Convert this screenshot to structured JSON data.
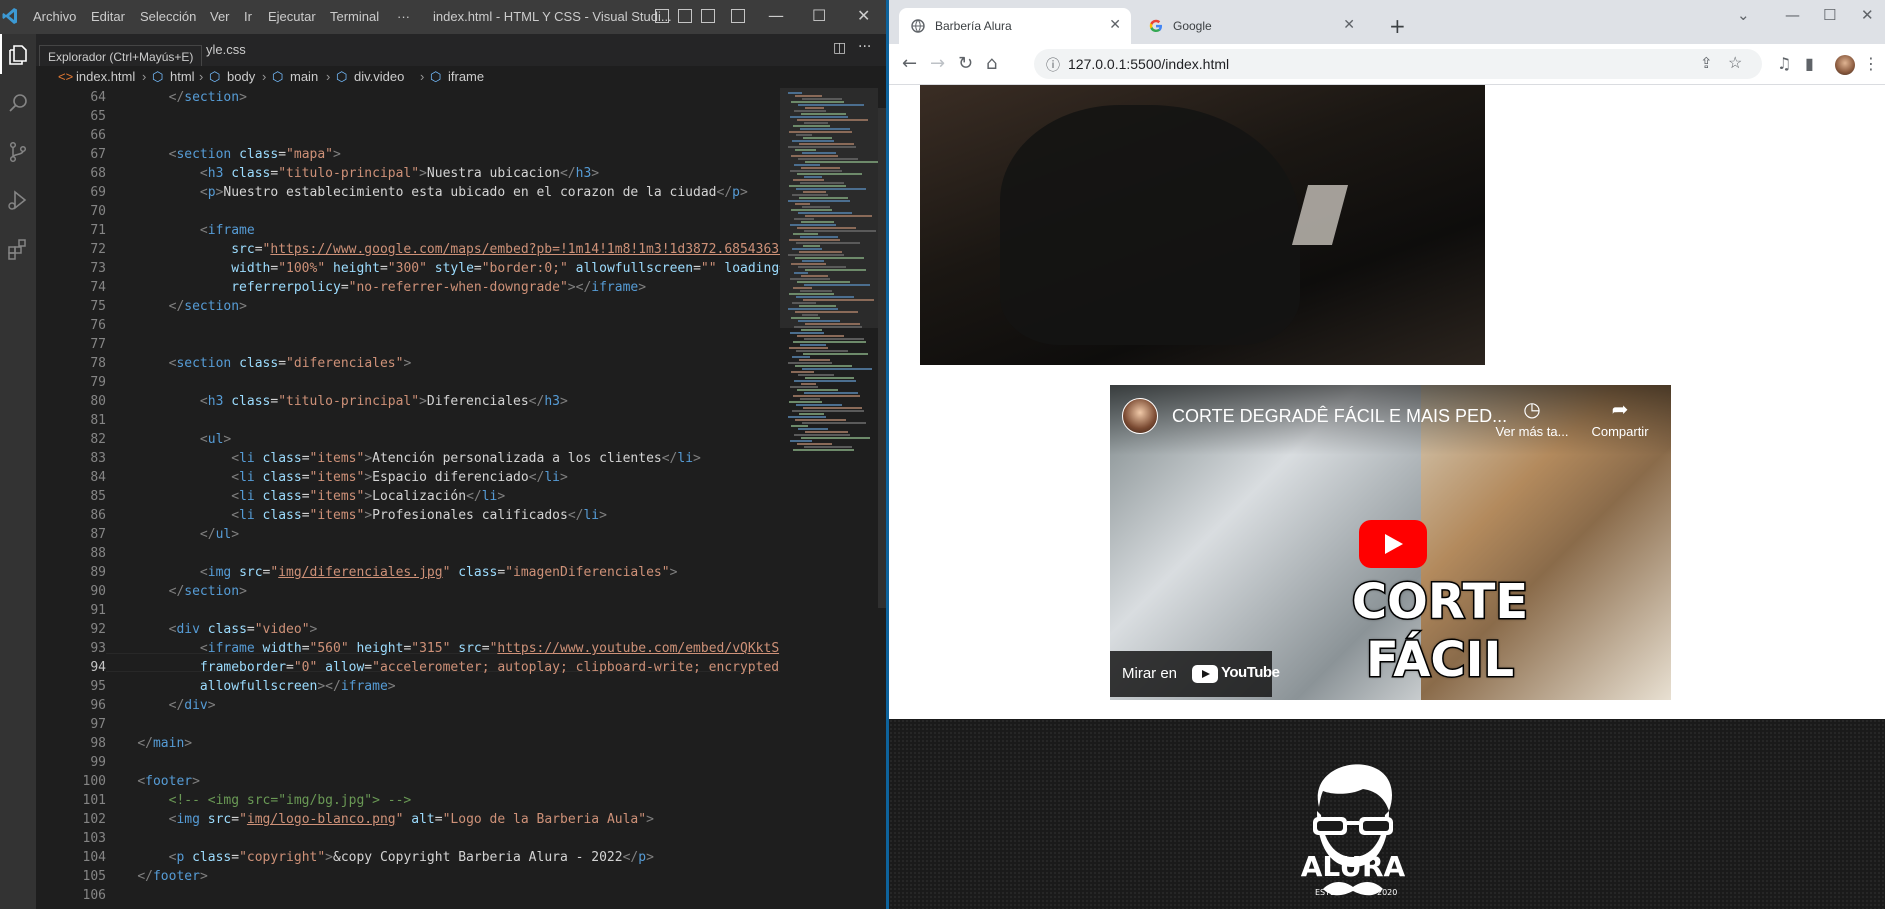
{
  "vscode": {
    "menu": [
      "Archivo",
      "Editar",
      "Selección",
      "Ver",
      "Ir",
      "Ejecutar",
      "Terminal",
      "···"
    ],
    "window_title": "index.html - HTML Y CSS - Visual Studi...",
    "tooltip": "Explorador (Ctrl+Mayús+E)",
    "partial_tab": "yle.css",
    "breadcrumb": [
      "index.html",
      "html",
      "body",
      "main",
      "div.video",
      "iframe"
    ],
    "active_line": 94,
    "line_numbers": [
      64,
      65,
      66,
      67,
      68,
      69,
      70,
      71,
      72,
      73,
      74,
      75,
      76,
      77,
      78,
      79,
      80,
      81,
      82,
      83,
      84,
      85,
      86,
      87,
      88,
      89,
      90,
      91,
      92,
      93,
      94,
      95,
      96,
      97,
      98,
      99,
      100,
      101,
      102,
      103,
      104,
      105,
      106
    ]
  },
  "chrome": {
    "tabs": [
      {
        "title": "Barbería Alura",
        "icon": "globe-icon"
      },
      {
        "title": "Google",
        "icon": "google-icon"
      }
    ],
    "url": "127.0.0.1:5500/index.html",
    "youtube": {
      "title": "CORTE DEGRADÊ FÁCIL E MAIS PED...",
      "watch_later": "Ver más ta...",
      "share": "Compartir",
      "overlay_line1": "CORTE",
      "overlay_line2": "FÁCIL",
      "watch_on": "Mirar en",
      "brand": "YouTube"
    },
    "footer_logo": "ALURA",
    "logo_estd": "ESTD",
    "logo_year": "2020"
  }
}
